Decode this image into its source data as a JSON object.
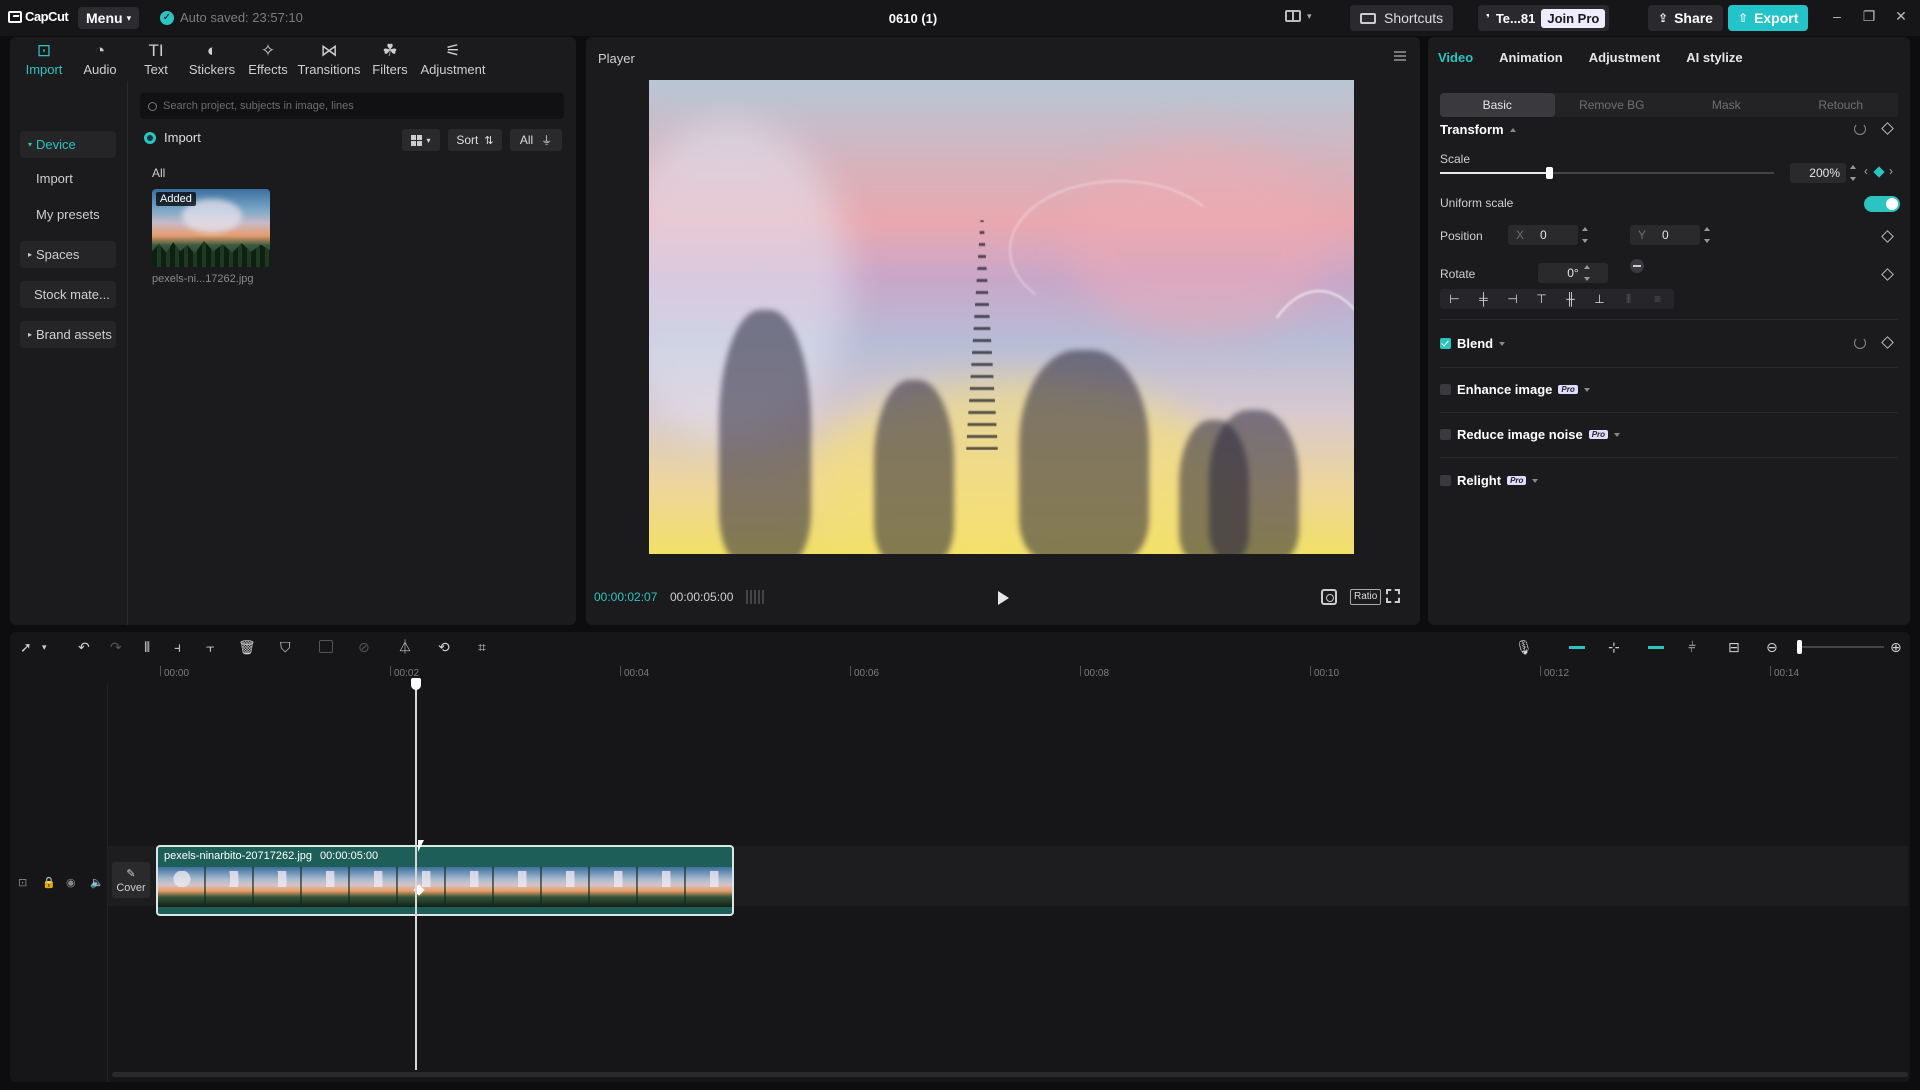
{
  "app": {
    "logo": "CapCut",
    "menu_label": "Menu",
    "autosave": "Auto saved: 23:57:10",
    "project_title": "0610 (1)",
    "shortcuts_label": "Shortcuts",
    "team_label": "Te...81",
    "join_pro_label": "Join Pro",
    "share_label": "Share",
    "export_label": "Export"
  },
  "left_panel": {
    "tabs": [
      {
        "label": "Import",
        "icon": "import-icon",
        "glyph": "⊡"
      },
      {
        "label": "Audio",
        "icon": "audio-icon",
        "glyph": "◔"
      },
      {
        "label": "Text",
        "icon": "text-icon",
        "glyph": "TI"
      },
      {
        "label": "Stickers",
        "icon": "stickers-icon",
        "glyph": "◐"
      },
      {
        "label": "Effects",
        "icon": "effects-icon",
        "glyph": "✧"
      },
      {
        "label": "Transitions",
        "icon": "transitions-icon",
        "glyph": "⋈"
      },
      {
        "label": "Filters",
        "icon": "filters-icon",
        "glyph": "☘"
      },
      {
        "label": "Adjustment",
        "icon": "adjustment-icon",
        "glyph": "⚟"
      }
    ],
    "side_nav": {
      "device": "Device",
      "import": "Import",
      "my_presets": "My presets",
      "spaces": "Spaces",
      "stock": "Stock mate...",
      "brand": "Brand assets"
    },
    "search_placeholder": "Search project, subjects in image, lines",
    "import_label": "Import",
    "sort_label": "Sort",
    "filter_label": "All",
    "section_label": "All",
    "media": {
      "badge": "Added",
      "filename": "pexels-ni...17262.jpg"
    }
  },
  "player": {
    "title": "Player",
    "current_time": "00:00:02:07",
    "total_time": "00:00:05:00",
    "ratio_label": "Ratio"
  },
  "right_panel": {
    "tabs": [
      "Video",
      "Animation",
      "Adjustment",
      "AI stylize"
    ],
    "subtabs": [
      "Basic",
      "Remove BG",
      "Mask",
      "Retouch"
    ],
    "transform_title": "Transform",
    "scale_label": "Scale",
    "scale_value": "200%",
    "scale_fraction": 0.325,
    "uniform_scale_label": "Uniform scale",
    "position_label": "Position",
    "pos_x_label": "X",
    "pos_x_value": "0",
    "pos_y_label": "Y",
    "pos_y_value": "0",
    "rotate_label": "Rotate",
    "rotate_value": "0°",
    "blend_title": "Blend",
    "enhance_title": "Enhance image",
    "noise_title": "Reduce image noise",
    "relight_title": "Relight",
    "pro_badge": "Pro"
  },
  "timeline": {
    "ticks": [
      "00:00",
      "00:02",
      "00:04",
      "00:06",
      "00:08",
      "00:10",
      "00:12",
      "00:14"
    ],
    "cover_label": "Cover",
    "clip_name": "pexels-ninarbito-20717262.jpg",
    "clip_duration": "00:00:05:00"
  },
  "colors": {
    "accent": "#2bc4c0",
    "panel": "#1b1b1d",
    "clip": "#1d5e58"
  }
}
